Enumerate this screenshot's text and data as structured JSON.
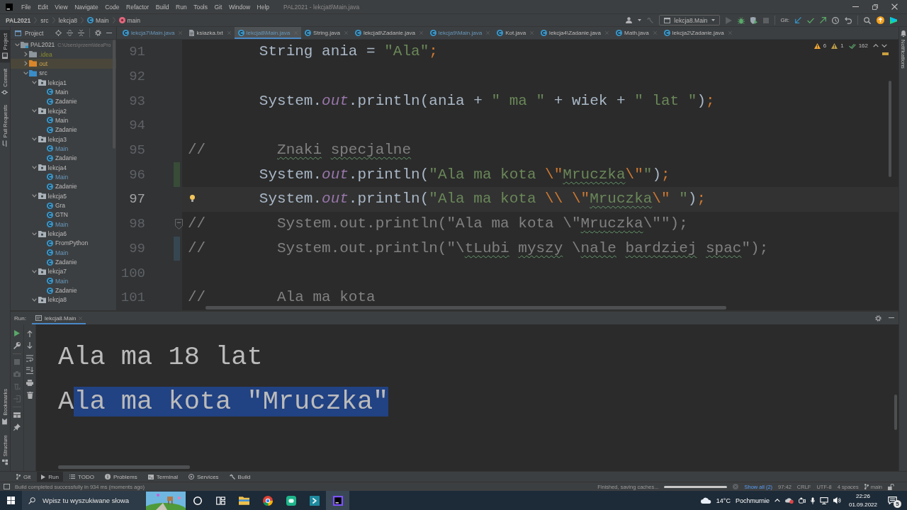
{
  "menubar": {
    "items": [
      "File",
      "Edit",
      "View",
      "Navigate",
      "Code",
      "Refactor",
      "Build",
      "Run",
      "Tools",
      "Git",
      "Window",
      "Help"
    ],
    "title": "PAL2021 - lekcja8\\Main.java"
  },
  "breadcrumb": [
    {
      "label": "PAL2021",
      "kind": "project"
    },
    {
      "label": "src",
      "kind": "folder"
    },
    {
      "label": "lekcja8",
      "kind": "folder"
    },
    {
      "label": "Main",
      "kind": "class"
    },
    {
      "label": "main",
      "kind": "method"
    }
  ],
  "toolbar": {
    "run_config": "lekcja8.Main",
    "run_buttons": [
      {
        "kind": "run",
        "disabled": true
      },
      {
        "kind": "debug",
        "disabled": false
      },
      {
        "kind": "coverage",
        "disabled": false
      },
      {
        "kind": "stop",
        "disabled": true
      }
    ],
    "git_label": "Git:"
  },
  "tool_stripes": {
    "left_top": [
      {
        "label": "Project",
        "kind": "project",
        "selected": true
      },
      {
        "label": "Commit",
        "kind": "commit",
        "selected": false
      },
      {
        "label": "Pull Requests",
        "kind": "pull_requests",
        "selected": false
      }
    ],
    "left_bottom": [
      {
        "label": "Bookmarks",
        "kind": "bookmarks",
        "selected": false
      },
      {
        "label": "Structure",
        "kind": "structure",
        "selected": false
      }
    ],
    "right": [
      {
        "label": "Notifications",
        "kind": "notifications",
        "selected": false
      }
    ]
  },
  "project_panel": {
    "title": "Project",
    "tree": [
      {
        "label": "PAL2021",
        "path": "C:\\Users\\przem\\IdeaPro",
        "kind": "module",
        "modified": false,
        "expanded": true,
        "selected": false,
        "children": [
          {
            "label": ".idea",
            "kind": "ignored",
            "modified": false,
            "expanded": false,
            "selected": false
          },
          {
            "label": "out",
            "kind": "excluded",
            "modified": false,
            "expanded": false,
            "selected": true
          },
          {
            "label": "src",
            "kind": "source",
            "modified": false,
            "expanded": true,
            "selected": false,
            "children": [
              {
                "label": "lekcja1",
                "kind": "package",
                "modified": false,
                "expanded": true,
                "selected": false,
                "children": [
                  {
                    "label": "Main",
                    "kind": "class",
                    "modified": false,
                    "selected": false
                  },
                  {
                    "label": "Zadanie",
                    "kind": "class",
                    "modified": false,
                    "selected": false
                  }
                ]
              },
              {
                "label": "lekcja2",
                "kind": "package",
                "modified": false,
                "expanded": true,
                "selected": false,
                "children": [
                  {
                    "label": "Main",
                    "kind": "class",
                    "modified": false,
                    "selected": false
                  },
                  {
                    "label": "Zadanie",
                    "kind": "class",
                    "modified": false,
                    "selected": false
                  }
                ]
              },
              {
                "label": "lekcja3",
                "kind": "package",
                "modified": false,
                "expanded": true,
                "selected": false,
                "children": [
                  {
                    "label": "Main",
                    "kind": "class",
                    "modified": true,
                    "selected": false
                  },
                  {
                    "label": "Zadanie",
                    "kind": "class",
                    "modified": false,
                    "selected": false
                  }
                ]
              },
              {
                "label": "lekcja4",
                "kind": "package",
                "modified": false,
                "expanded": true,
                "selected": false,
                "children": [
                  {
                    "label": "Main",
                    "kind": "class",
                    "modified": true,
                    "selected": false
                  },
                  {
                    "label": "Zadanie",
                    "kind": "class",
                    "modified": false,
                    "selected": false
                  }
                ]
              },
              {
                "label": "lekcja5",
                "kind": "package",
                "modified": false,
                "expanded": true,
                "selected": false,
                "children": [
                  {
                    "label": "Gra",
                    "kind": "class",
                    "modified": false,
                    "selected": false
                  },
                  {
                    "label": "GTN",
                    "kind": "class",
                    "modified": false,
                    "selected": false
                  },
                  {
                    "label": "Main",
                    "kind": "class",
                    "modified": true,
                    "selected": false
                  }
                ]
              },
              {
                "label": "lekcja6",
                "kind": "package",
                "modified": false,
                "expanded": true,
                "selected": false,
                "children": [
                  {
                    "label": "FromPython",
                    "kind": "class",
                    "modified": false,
                    "selected": false
                  },
                  {
                    "label": "Main",
                    "kind": "class",
                    "modified": true,
                    "selected": false
                  },
                  {
                    "label": "Zadanie",
                    "kind": "class",
                    "modified": false,
                    "selected": false
                  }
                ]
              },
              {
                "label": "lekcja7",
                "kind": "package",
                "modified": false,
                "expanded": true,
                "selected": false,
                "children": [
                  {
                    "label": "Main",
                    "kind": "class",
                    "modified": true,
                    "selected": false
                  },
                  {
                    "label": "Zadanie",
                    "kind": "class",
                    "modified": false,
                    "selected": false
                  }
                ]
              },
              {
                "label": "lekcja8",
                "kind": "package",
                "modified": false,
                "expanded": true,
                "selected": false
              }
            ]
          }
        ]
      }
    ]
  },
  "tabs": [
    {
      "label": "lekcja7\\Main.java",
      "kind": "class",
      "modified": true,
      "selected": false
    },
    {
      "label": "ksiazka.txt",
      "kind": "text",
      "modified": false,
      "selected": false
    },
    {
      "label": "lekcja8\\Main.java",
      "kind": "class",
      "modified": true,
      "selected": true
    },
    {
      "label": "String.java",
      "kind": "class",
      "modified": false,
      "selected": false
    },
    {
      "label": "lekcja8\\Zadanie.java",
      "kind": "class",
      "modified": false,
      "selected": false
    },
    {
      "label": "lekcja9\\Main.java",
      "kind": "class",
      "modified": true,
      "selected": false
    },
    {
      "label": "Kot.java",
      "kind": "class",
      "modified": false,
      "selected": false
    },
    {
      "label": "lekcja4\\Zadanie.java",
      "kind": "class",
      "modified": false,
      "selected": false
    },
    {
      "label": "Math.java",
      "kind": "class",
      "modified": false,
      "selected": false
    },
    {
      "label": "lekcja2\\Zadanie.java",
      "kind": "class",
      "modified": false,
      "selected": false
    }
  ],
  "editor": {
    "inspections": {
      "warnings": "6",
      "weak_warnings": "1",
      "typos": "162"
    },
    "lines": [
      {
        "number": "91",
        "current": false,
        "added": false,
        "modified": false,
        "has_intention": false,
        "foldable": false,
        "segments": [
          {
            "text": "        String ania = ",
            "kind": "plain"
          },
          {
            "text": "\"Ala\"",
            "kind": "string"
          },
          {
            "text": ";",
            "kind": "punct"
          }
        ]
      },
      {
        "number": "92",
        "current": false,
        "added": false,
        "modified": false,
        "has_intention": false,
        "foldable": false
      },
      {
        "number": "93",
        "current": false,
        "added": false,
        "modified": false,
        "has_intention": false,
        "foldable": false,
        "segments": [
          {
            "text": "        System.",
            "kind": "plain"
          },
          {
            "text": "out",
            "kind": "field"
          },
          {
            "text": ".println(ania + ",
            "kind": "plain"
          },
          {
            "text": "\" ma \"",
            "kind": "string"
          },
          {
            "text": " + wiek + ",
            "kind": "plain"
          },
          {
            "text": "\" lat \"",
            "kind": "string"
          },
          {
            "text": ")",
            "kind": "plain"
          },
          {
            "text": ";",
            "kind": "punct"
          }
        ]
      },
      {
        "number": "94",
        "current": false,
        "added": false,
        "modified": false,
        "has_intention": false,
        "foldable": false
      },
      {
        "number": "95",
        "current": false,
        "added": false,
        "modified": false,
        "has_intention": false,
        "foldable": false,
        "segments": [
          {
            "text": "//        ",
            "kind": "comment"
          },
          {
            "text": "Znaki",
            "kind": "comment_typo"
          },
          {
            "text": " specjalne",
            "kind": "comment_typo"
          }
        ]
      },
      {
        "number": "96",
        "current": false,
        "added": true,
        "modified": false,
        "has_intention": false,
        "foldable": false,
        "segments": [
          {
            "text": "        System.",
            "kind": "plain"
          },
          {
            "text": "out",
            "kind": "field"
          },
          {
            "text": ".println(",
            "kind": "plain"
          },
          {
            "text": "\"Ala ma kota ",
            "kind": "string"
          },
          {
            "text": "\\\"",
            "kind": "escape"
          },
          {
            "text": "Mruczka",
            "kind": "string_typo"
          },
          {
            "text": "\\\"",
            "kind": "escape"
          },
          {
            "text": "\"",
            "kind": "string"
          },
          {
            "text": ")",
            "kind": "plain"
          },
          {
            "text": ";",
            "kind": "punct"
          }
        ]
      },
      {
        "number": "97",
        "current": true,
        "added": false,
        "modified": false,
        "has_intention": true,
        "foldable": false,
        "segments": [
          {
            "text": "        System.",
            "kind": "plain"
          },
          {
            "text": "out",
            "kind": "field"
          },
          {
            "text": ".println(",
            "kind": "plain"
          },
          {
            "text": "\"Ala ma kota ",
            "kind": "string"
          },
          {
            "text": "\\\\ ",
            "kind": "escape"
          },
          {
            "text": "\\\"",
            "kind": "escape"
          },
          {
            "text": "Mruczka",
            "kind": "string_typo"
          },
          {
            "text": "\\\"",
            "kind": "escape"
          },
          {
            "text": " \"",
            "kind": "string"
          },
          {
            "text": ")",
            "kind": "plain"
          },
          {
            "text": ";",
            "kind": "punct"
          }
        ]
      },
      {
        "number": "98",
        "current": false,
        "added": false,
        "modified": false,
        "has_intention": false,
        "foldable": true,
        "segments": [
          {
            "text": "//        System.out.println(\"Ala ma kota \\\"",
            "kind": "comment"
          },
          {
            "text": "Mruczka",
            "kind": "comment_typo"
          },
          {
            "text": "\\\"\");",
            "kind": "comment"
          }
        ]
      },
      {
        "number": "99",
        "current": false,
        "added": false,
        "modified": true,
        "has_intention": false,
        "foldable": false,
        "segments": [
          {
            "text": "//        System.out.println(\"\\",
            "kind": "comment"
          },
          {
            "text": "tLubi",
            "kind": "comment_typo"
          },
          {
            "text": " myszy",
            "kind": "comment_typo"
          },
          {
            "text": " \\",
            "kind": "comment"
          },
          {
            "text": "nale",
            "kind": "comment_typo"
          },
          {
            "text": " bardziej",
            "kind": "comment_typo"
          },
          {
            "text": " spac",
            "kind": "comment_typo"
          },
          {
            "text": "\");",
            "kind": "comment"
          }
        ]
      },
      {
        "number": "100",
        "current": false,
        "added": false,
        "modified": false,
        "has_intention": false,
        "foldable": false
      },
      {
        "number": "101",
        "current": false,
        "added": false,
        "modified": false,
        "has_intention": false,
        "foldable": false,
        "segments": [
          {
            "text": "//        Ala ma kota",
            "kind": "comment"
          }
        ]
      }
    ]
  },
  "run_panel": {
    "label": "Run:",
    "tab": {
      "label": "lekcja8.Main",
      "selected": true
    },
    "toolbar_actions": [
      {
        "kind": "rerun",
        "disabled": false
      },
      {
        "kind": "wrench",
        "disabled": false
      },
      {
        "kind": "stop",
        "disabled": true
      },
      {
        "kind": "camera",
        "disabled": true
      },
      {
        "kind": "clear",
        "disabled": true
      },
      {
        "kind": "login",
        "disabled": true
      },
      {
        "kind": "layout",
        "disabled": false
      },
      {
        "kind": "pin",
        "disabled": false
      }
    ],
    "toolbar_console": [
      {
        "kind": "up",
        "disabled": false
      },
      {
        "kind": "down",
        "disabled": false
      },
      {
        "kind": "wrap",
        "disabled": false
      },
      {
        "kind": "scroll_end",
        "disabled": false
      },
      {
        "kind": "print",
        "disabled": false
      },
      {
        "kind": "trash",
        "disabled": false
      }
    ],
    "console": [
      {
        "segments": [
          {
            "text": "Ala ma 18 lat",
            "selected": false
          }
        ]
      },
      {
        "segments": [
          {
            "text": "A",
            "selected": false
          },
          {
            "text": "la ma kota \"Mruczka\"",
            "selected": true
          }
        ]
      }
    ]
  },
  "tool_windows": [
    {
      "label": "Git",
      "kind": "git",
      "selected": false
    },
    {
      "label": "Run",
      "kind": "run",
      "selected": true
    },
    {
      "label": "TODO",
      "kind": "todo",
      "selected": false
    },
    {
      "label": "Problems",
      "kind": "problems",
      "selected": false
    },
    {
      "label": "Terminal",
      "kind": "terminal",
      "selected": false
    },
    {
      "label": "Services",
      "kind": "services",
      "selected": false
    },
    {
      "label": "Build",
      "kind": "build",
      "selected": false
    }
  ],
  "status_bar": {
    "message": "Build completed successfully in 934 ms (moments ago)",
    "task": "Finished, saving caches...",
    "level": 1,
    "show_all": "Show all (2)",
    "position": "97:42",
    "line_separator": "CRLF",
    "encoding": "UTF-8",
    "indent": "4 spaces",
    "branch": "main",
    "locked": false
  },
  "taskbar": {
    "search_placeholder": "Wpisz tu wyszukiwane słowa",
    "apps": [
      {
        "kind": "explorer",
        "selected": false
      },
      {
        "kind": "browser",
        "selected": false
      },
      {
        "kind": "chat",
        "selected": false
      },
      {
        "kind": "code",
        "selected": false
      },
      {
        "kind": "ide",
        "selected": true
      }
    ],
    "temperature": "14°C",
    "weather": "Pochmurnie",
    "time": "22:26",
    "date": "01.09.2022",
    "notifications": "5"
  }
}
